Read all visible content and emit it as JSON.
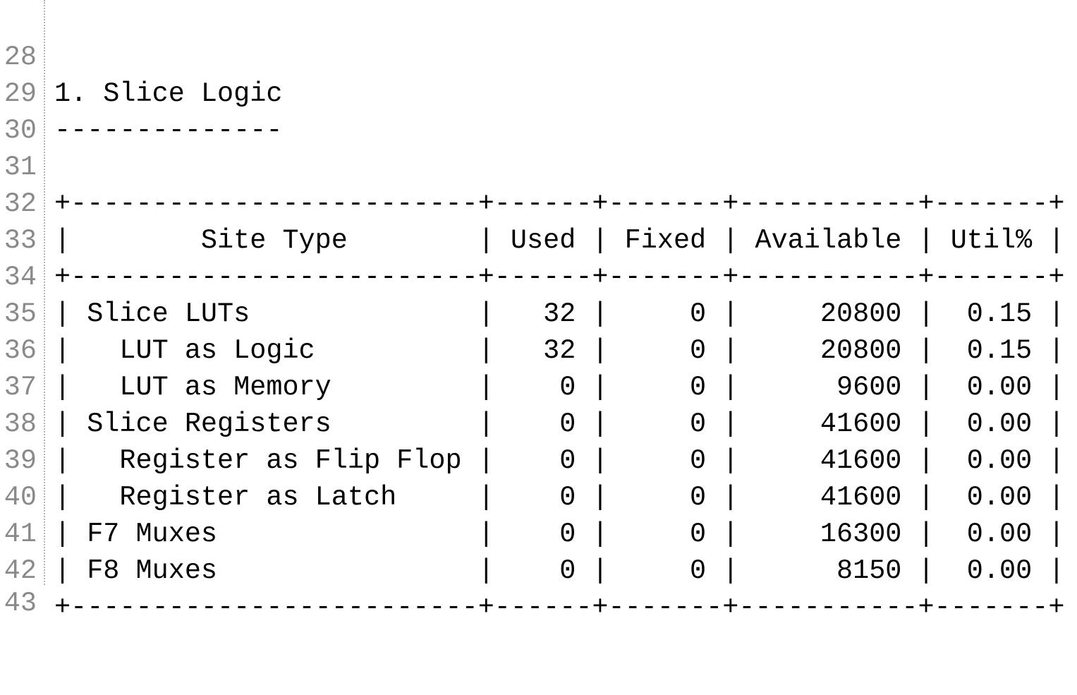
{
  "editor": {
    "lines": [
      {
        "number": "28",
        "text": "1. Slice Logic"
      },
      {
        "number": "29",
        "text": "--------------"
      },
      {
        "number": "30",
        "text": ""
      },
      {
        "number": "31",
        "text": "+-------------------------+------+-------+-----------+-------+"
      },
      {
        "number": "32",
        "text": "|        Site Type        | Used | Fixed | Available | Util% |"
      },
      {
        "number": "33",
        "text": "+-------------------------+------+-------+-----------+-------+"
      },
      {
        "number": "34",
        "text": "| Slice LUTs              |   32 |     0 |     20800 |  0.15 |"
      },
      {
        "number": "35",
        "text": "|   LUT as Logic          |   32 |     0 |     20800 |  0.15 |"
      },
      {
        "number": "36",
        "text": "|   LUT as Memory         |    0 |     0 |      9600 |  0.00 |"
      },
      {
        "number": "37",
        "text": "| Slice Registers         |    0 |     0 |     41600 |  0.00 |"
      },
      {
        "number": "38",
        "text": "|   Register as Flip Flop |    0 |     0 |     41600 |  0.00 |"
      },
      {
        "number": "39",
        "text": "|   Register as Latch     |    0 |     0 |     41600 |  0.00 |"
      },
      {
        "number": "40",
        "text": "| F7 Muxes                |    0 |     0 |     16300 |  0.00 |"
      },
      {
        "number": "41",
        "text": "| F8 Muxes                |    0 |     0 |      8150 |  0.00 |"
      },
      {
        "number": "42",
        "text": "+-------------------------+------+-------+-----------+-------+"
      },
      {
        "number": "43",
        "text": ""
      }
    ]
  }
}
